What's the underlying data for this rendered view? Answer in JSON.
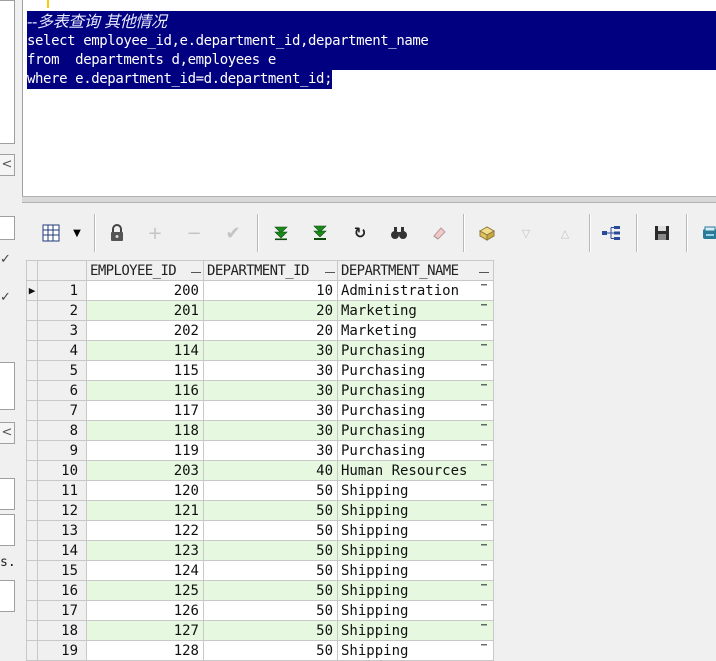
{
  "editor": {
    "line1": "--多表查询 其他情况",
    "line2": "select employee_id,e.department_id,department_name",
    "line3": "from  departments d,employees e",
    "line4": "where e.department_id=d.department_id;"
  },
  "left_strip": {
    "fragment_text": "s."
  },
  "grid": {
    "columns": [
      "EMPLOYEE_ID",
      "DEPARTMENT_ID",
      "DEPARTMENT_NAME"
    ],
    "rows": [
      {
        "n": "1",
        "emp": "200",
        "dep": "10",
        "name": "Administration"
      },
      {
        "n": "2",
        "emp": "201",
        "dep": "20",
        "name": "Marketing"
      },
      {
        "n": "3",
        "emp": "202",
        "dep": "20",
        "name": "Marketing"
      },
      {
        "n": "4",
        "emp": "114",
        "dep": "30",
        "name": "Purchasing"
      },
      {
        "n": "5",
        "emp": "115",
        "dep": "30",
        "name": "Purchasing"
      },
      {
        "n": "6",
        "emp": "116",
        "dep": "30",
        "name": "Purchasing"
      },
      {
        "n": "7",
        "emp": "117",
        "dep": "30",
        "name": "Purchasing"
      },
      {
        "n": "8",
        "emp": "118",
        "dep": "30",
        "name": "Purchasing"
      },
      {
        "n": "9",
        "emp": "119",
        "dep": "30",
        "name": "Purchasing"
      },
      {
        "n": "10",
        "emp": "203",
        "dep": "40",
        "name": "Human Resources"
      },
      {
        "n": "11",
        "emp": "120",
        "dep": "50",
        "name": "Shipping"
      },
      {
        "n": "12",
        "emp": "121",
        "dep": "50",
        "name": "Shipping"
      },
      {
        "n": "13",
        "emp": "122",
        "dep": "50",
        "name": "Shipping"
      },
      {
        "n": "14",
        "emp": "123",
        "dep": "50",
        "name": "Shipping"
      },
      {
        "n": "15",
        "emp": "124",
        "dep": "50",
        "name": "Shipping"
      },
      {
        "n": "16",
        "emp": "125",
        "dep": "50",
        "name": "Shipping"
      },
      {
        "n": "17",
        "emp": "126",
        "dep": "50",
        "name": "Shipping"
      },
      {
        "n": "18",
        "emp": "127",
        "dep": "50",
        "name": "Shipping"
      },
      {
        "n": "19",
        "emp": "128",
        "dep": "50",
        "name": "Shipping"
      }
    ]
  }
}
